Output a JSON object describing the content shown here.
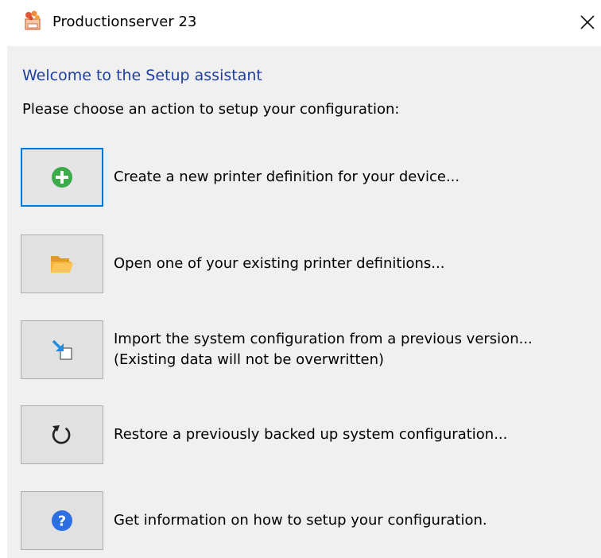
{
  "window": {
    "title": "Productionserver 23",
    "app_icon": "productionserver-app-icon",
    "close_icon": "close-icon"
  },
  "content": {
    "heading": "Welcome to the Setup assistant",
    "instruction": "Please choose an action to setup your configuration:"
  },
  "actions": [
    {
      "icon": "plus-circle-icon",
      "label": "Create a new printer definition for your device...",
      "focused": true
    },
    {
      "icon": "folder-open-icon",
      "label": "Open one of your existing printer definitions..."
    },
    {
      "icon": "import-arrow-icon",
      "label": "Import the system configuration from a previous version...",
      "label2": "(Existing data will not be overwritten)"
    },
    {
      "icon": "restore-refresh-icon",
      "label": "Restore a previously backed up system configuration..."
    },
    {
      "icon": "help-question-icon",
      "label": "Get information on how to setup your configuration."
    }
  ],
  "colors": {
    "heading": "#1f3ea1",
    "focus_border": "#0078d7",
    "plus_green": "#3cab49",
    "folder_orange": "#f6b13a",
    "import_blue": "#1d8fe0",
    "help_blue": "#2b6fe3"
  }
}
